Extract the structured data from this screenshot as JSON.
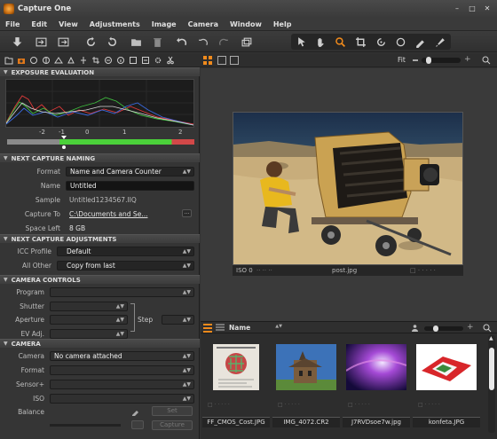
{
  "window": {
    "title": "Capture One"
  },
  "menu": [
    "File",
    "Edit",
    "View",
    "Adjustments",
    "Image",
    "Camera",
    "Window",
    "Help"
  ],
  "icons": [
    "download-icon",
    "import-icon",
    "export-icon",
    "rotate-ccw-icon",
    "rotate-cw-icon",
    "folder-icon",
    "trash-icon",
    "undo-icon",
    "redo-icon",
    "stack-icon"
  ],
  "viewer": {
    "zoom_label": "Fit",
    "iso": "ISO 0",
    "filename": "post.jpg"
  },
  "exposure": {
    "title": "EXPOSURE EVALUATION",
    "ticks": [
      "-2",
      "-1",
      "0",
      "1",
      "2"
    ]
  },
  "naming": {
    "title": "NEXT CAPTURE NAMING",
    "format_label": "Format",
    "format_value": "Name and Camera Counter",
    "name_label": "Name",
    "name_value": "Untitled",
    "sample_label": "Sample",
    "sample_value": "Untitled1234567.IIQ",
    "capture_to_label": "Capture To",
    "capture_to_value": "C:\\Documents and Se...",
    "space_left_label": "Space Left",
    "space_left_value": "8 GB"
  },
  "adjustments": {
    "title": "NEXT CAPTURE ADJUSTMENTS",
    "icc_label": "ICC Profile",
    "icc_value": "Default",
    "other_label": "All Other",
    "other_value": "Copy from last"
  },
  "camera_controls": {
    "title": "CAMERA CONTROLS",
    "program_label": "Program",
    "shutter_label": "Shutter",
    "aperture_label": "Aperture",
    "ev_label": "EV Adj.",
    "step_label": "Step"
  },
  "camera": {
    "title": "CAMERA",
    "camera_label": "Camera",
    "camera_value": "No camera attached",
    "format_label": "Format",
    "sensor_label": "Sensor+",
    "iso_label": "ISO",
    "balance_label": "Balance",
    "set_label": "Set",
    "capture_label": "Capture"
  },
  "browser": {
    "sort_label": "Name",
    "thumbs": [
      "FF_CMOS_Cost.JPG",
      "IMG_4072.CR2",
      "J7RVDsoe7w.jpg",
      "konfeta.JPG"
    ]
  }
}
